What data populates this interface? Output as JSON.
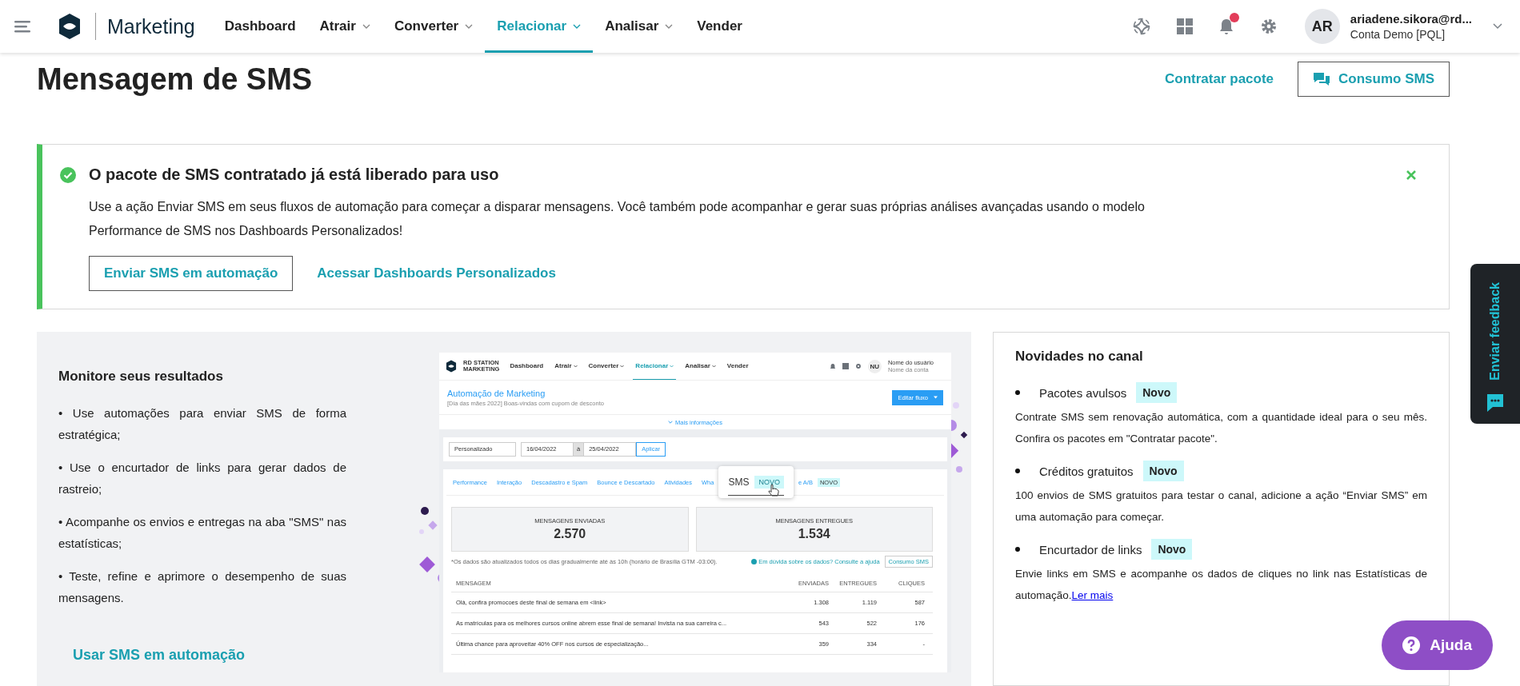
{
  "header": {
    "brand": "Marketing",
    "nav": [
      {
        "label": "Dashboard",
        "dropdown": false,
        "selected": false
      },
      {
        "label": "Atrair",
        "dropdown": true,
        "selected": false
      },
      {
        "label": "Converter",
        "dropdown": true,
        "selected": false
      },
      {
        "label": "Relacionar",
        "dropdown": true,
        "selected": true
      },
      {
        "label": "Analisar",
        "dropdown": true,
        "selected": false
      },
      {
        "label": "Vender",
        "dropdown": false,
        "selected": false
      }
    ],
    "icons": [
      {
        "kind": "ai"
      },
      {
        "kind": "apps"
      },
      {
        "kind": "bell",
        "badge": true
      },
      {
        "kind": "gear"
      }
    ],
    "user": {
      "initials": "AR",
      "email": "ariadene.sikora@rd...",
      "account": "Conta Demo [PQL]"
    }
  },
  "page": {
    "title": "Mensagem de SMS",
    "link": "Contratar pacote",
    "button": "Consumo SMS"
  },
  "alert": {
    "title": "O pacote de SMS contratado já está liberado para uso",
    "text": "Use a ação Enviar SMS em seus fluxos de automação para começar a disparar mensagens. Você também pode acompanhar e gerar suas próprias análises avançadas usando o modelo Performance de SMS nos Dashboards Personalizados!",
    "button": "Enviar SMS em automação",
    "link": "Acessar Dashboards Personalizados",
    "closable": true
  },
  "monitor": {
    "title": "Monitore seus resultados",
    "items": [
      "•    Use automações para enviar SMS de forma estratégica;",
      "•    Use o encurtador de links para gerar dados de rastreio;",
      "•    Acompanhe os envios e entregas na aba \"SMS\" nas estatísticas;",
      "•    Teste, refine e aprimore o desempenho de suas mensagens."
    ],
    "link": "Usar SMS em automação"
  },
  "sms_preview": {
    "logo": [
      "RD STATION",
      "MARKETING"
    ],
    "nav": [
      {
        "label": "Dashboard",
        "dropdown": false,
        "selected": false
      },
      {
        "label": "Atrair",
        "dropdown": true,
        "selected": false
      },
      {
        "label": "Converter",
        "dropdown": true,
        "selected": false
      },
      {
        "label": "Relacionar",
        "dropdown": true,
        "selected": true
      },
      {
        "label": "Analisar",
        "dropdown": true,
        "selected": false
      },
      {
        "label": "Vender",
        "dropdown": false,
        "selected": false
      }
    ],
    "user": {
      "initials": "NU",
      "name": "Nome do usuário",
      "account": "Nome da conta"
    },
    "title": "Automação de Marketing",
    "subtitle": "[Dia das mães 2022] Boas-vindas com cupom de desconto",
    "button": "Editar fluxo",
    "more": "Mais informações",
    "filter": {
      "period": "Personalizado",
      "from": "16/04/2022",
      "separator": "à",
      "to": "25/04/2022",
      "apply": "Aplicar"
    },
    "tabs": [
      {
        "label": "Performance"
      },
      {
        "label": "Interação"
      },
      {
        "label": "Descadastro e Spam"
      },
      {
        "label": "Bounce e Descartado"
      },
      {
        "label": "Atividades"
      },
      {
        "label": "Wha"
      },
      {
        "label": "e A/B",
        "badge": "NOVO"
      }
    ],
    "popup": {
      "label": "SMS",
      "badge": "NOVO"
    },
    "stats": [
      {
        "label": "MENSAGENS ENVIADAS",
        "value": "2.570"
      },
      {
        "label": "MENSAGENS ENTREGUES",
        "value": "1.534"
      }
    ],
    "note": "*Os dados são atualizados todos os dias gradualmente até às 10h (horário de Brasília GTM -03:00).",
    "help": "Em dúvida sobre os dados? Consulte a ajuda",
    "consumo": "Consumo SMS",
    "columns": [
      "MENSAGEM",
      "ENVIADAS",
      "ENTREGUES",
      "CLIQUES"
    ],
    "rows": [
      [
        "Olá, confira promocoes deste final de semana em <link>",
        "1.308",
        "1.119",
        "587"
      ],
      [
        "As matrículas para os melhores cursos online abrem esse final de semana! Invista na sua carreira c...",
        "543",
        "522",
        "176"
      ],
      [
        "Última chance para aproveitar 40% OFF nos cursos de especialização...",
        "359",
        "334",
        "-"
      ]
    ]
  },
  "news": {
    "title": "Novidades no canal",
    "items": [
      {
        "title": "Pacotes avulsos",
        "badge": "Novo",
        "text": "Contrate SMS sem renovação automática, com a quantidade ideal para o seu mês. Confira os pacotes em \"Contratar pacote\"."
      },
      {
        "title": "Créditos gratuitos",
        "badge": "Novo",
        "text": "100 envios de SMS gratuitos para testar o canal, adicione a ação “Enviar SMS” em uma automação para começar."
      },
      {
        "title": "Encurtador de links",
        "badge": "Novo",
        "text": "Envie links em SMS e acompanhe os dados de cliques no link nas Estatísticas de automação.",
        "link": "Ler mais"
      }
    ]
  },
  "feedback": "Enviar feedback",
  "help_button": "Ajuda"
}
